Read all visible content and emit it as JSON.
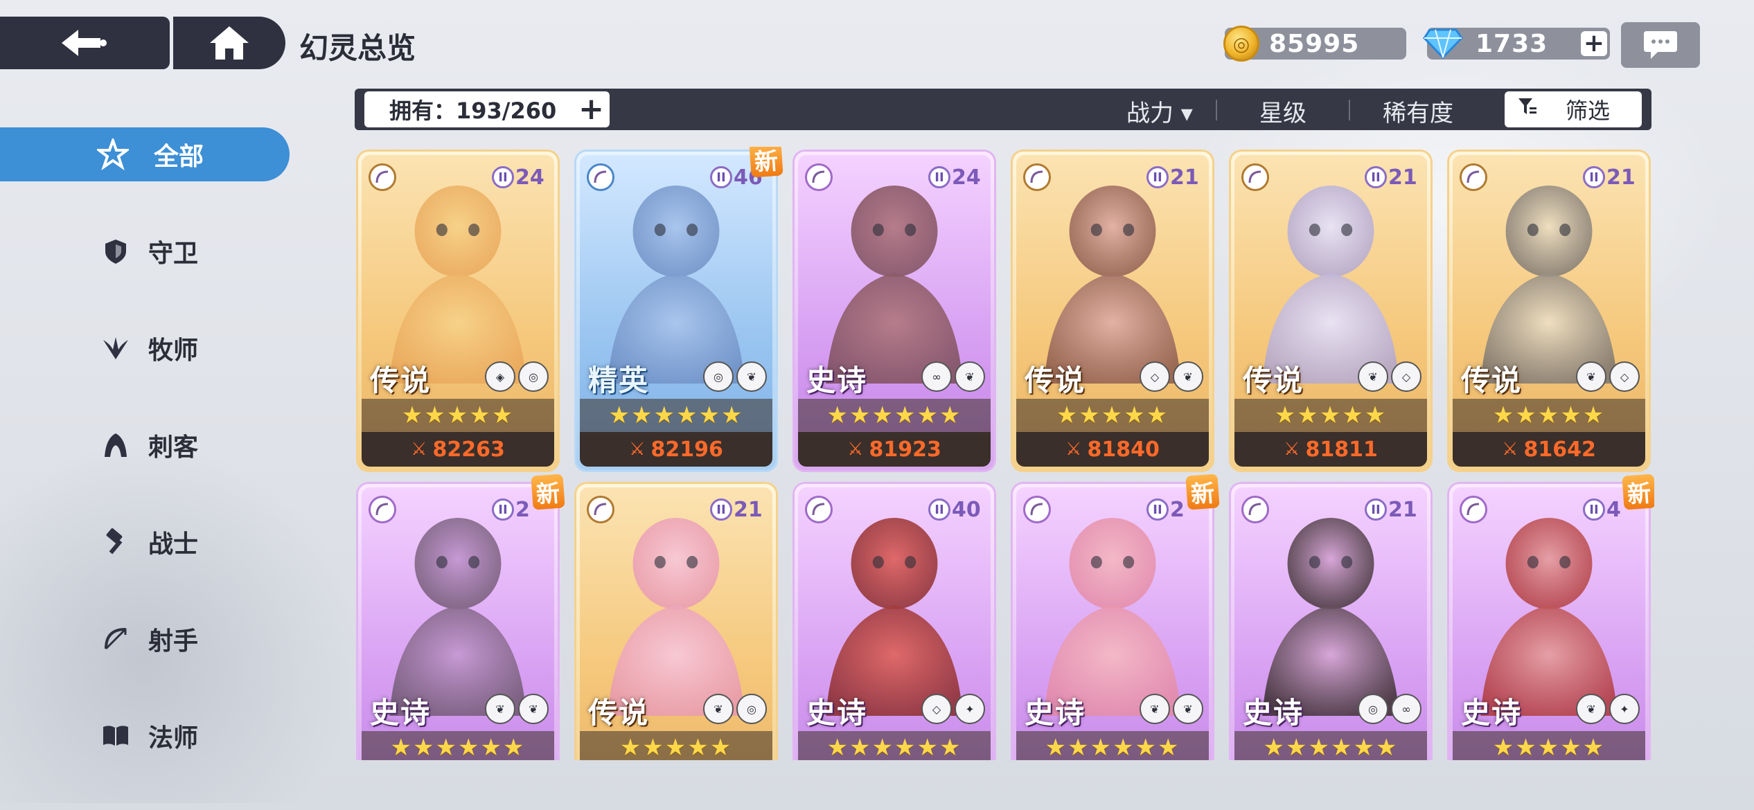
{
  "header": {
    "title": "幻灵总览",
    "coins": "85995",
    "gems": "1733",
    "gem_plus": "+",
    "back_icon": "back-arrow-icon",
    "home_icon": "home-icon",
    "chat_icon": "chat-bubble-icon"
  },
  "filter_bar": {
    "owned_label": "拥有：193/260",
    "owned_plus": "+",
    "sort_power": "战力 ▾",
    "sort_star": "星级",
    "sort_rarity": "稀有度",
    "filter_label": "筛选"
  },
  "sidebar": {
    "items": [
      {
        "label": "全部",
        "icon": "all-star-icon",
        "active": true
      },
      {
        "label": "守卫",
        "icon": "shield-icon",
        "active": false
      },
      {
        "label": "牧师",
        "icon": "priest-wings-icon",
        "active": false
      },
      {
        "label": "刺客",
        "icon": "assassin-hood-icon",
        "active": false
      },
      {
        "label": "战士",
        "icon": "hammer-icon",
        "active": false
      },
      {
        "label": "射手",
        "icon": "bow-icon",
        "active": false
      },
      {
        "label": "法师",
        "icon": "book-icon",
        "active": false
      }
    ]
  },
  "cards": [
    {
      "rarity": "传说",
      "rarity_key": "legend",
      "level": "24",
      "is_new": false,
      "stars": "★★★★★",
      "power": "82263"
    },
    {
      "rarity": "精英",
      "rarity_key": "elite",
      "level": "46",
      "is_new": true,
      "new_label": "新",
      "stars": "★★★★★★",
      "power": "82196"
    },
    {
      "rarity": "史诗",
      "rarity_key": "epic",
      "level": "24",
      "is_new": false,
      "stars": "★★★★★★",
      "power": "81923"
    },
    {
      "rarity": "传说",
      "rarity_key": "legend",
      "level": "21",
      "is_new": false,
      "stars": "★★★★★",
      "power": "81840"
    },
    {
      "rarity": "传说",
      "rarity_key": "legend",
      "level": "21",
      "is_new": false,
      "stars": "★★★★★",
      "power": "81811"
    },
    {
      "rarity": "传说",
      "rarity_key": "legend",
      "level": "21",
      "is_new": false,
      "stars": "★★★★★",
      "power": "81642"
    },
    {
      "rarity": "史诗",
      "rarity_key": "epic",
      "level": "2",
      "is_new": true,
      "new_label": "新",
      "stars": "★★★★★★",
      "power": ""
    },
    {
      "rarity": "传说",
      "rarity_key": "legend",
      "level": "21",
      "is_new": false,
      "stars": "★★★★★",
      "power": ""
    },
    {
      "rarity": "史诗",
      "rarity_key": "epic",
      "level": "40",
      "is_new": false,
      "stars": "★★★★★★",
      "power": ""
    },
    {
      "rarity": "史诗",
      "rarity_key": "epic",
      "level": "2",
      "is_new": true,
      "new_label": "新",
      "stars": "★★★★★★",
      "power": ""
    },
    {
      "rarity": "史诗",
      "rarity_key": "epic",
      "level": "21",
      "is_new": false,
      "stars": "★★★★★★",
      "power": ""
    },
    {
      "rarity": "史诗",
      "rarity_key": "epic",
      "level": "4",
      "is_new": true,
      "new_label": "新",
      "stars": "★★★★★",
      "power": ""
    }
  ],
  "colors": {
    "accent": "#3d8fd6",
    "dark_bar": "#363846",
    "power_text": "#ff6a2a",
    "star": "#ffd84a"
  }
}
